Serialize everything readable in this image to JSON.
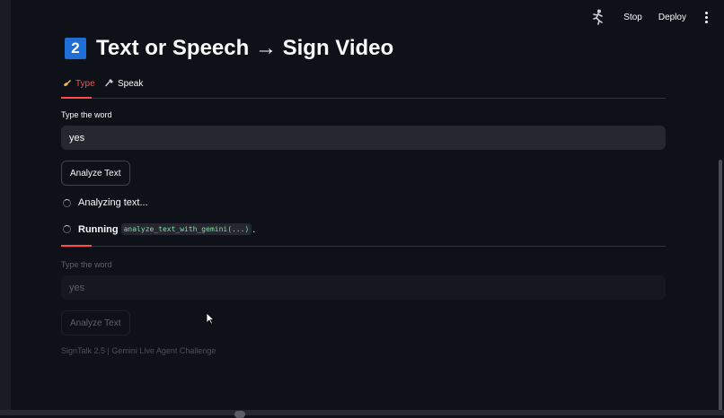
{
  "topbar": {
    "running_icon": "running-man-icon",
    "stop_label": "Stop",
    "deploy_label": "Deploy",
    "menu_icon": "kebab-menu-icon"
  },
  "header": {
    "badge": "2",
    "badge_color": "#1f6fd6",
    "title": "Text or Speech → Sign Video"
  },
  "tabs": [
    {
      "icon": "writing-hand-icon",
      "label": "Type",
      "active": true
    },
    {
      "icon": "microphone-icon",
      "label": "Speak",
      "active": false
    }
  ],
  "form": {
    "input_label": "Type the word",
    "input_value": "yes",
    "analyze_button": "Analyze Text"
  },
  "status": {
    "analyzing": "Analyzing text...",
    "running_label": "Running",
    "running_code": "analyze_text_with_gemini(...)",
    "running_suffix": "."
  },
  "stale_form": {
    "input_label": "Type the word",
    "input_value": "yes",
    "analyze_button": "Analyze Text"
  },
  "footer": {
    "text": "SignTalk 2.5 | Gemini Live Agent Challenge"
  },
  "colors": {
    "background": "#0e1117",
    "accent": "#ff4b4b",
    "input_bg": "#262730",
    "code_text": "#7ce29b"
  }
}
